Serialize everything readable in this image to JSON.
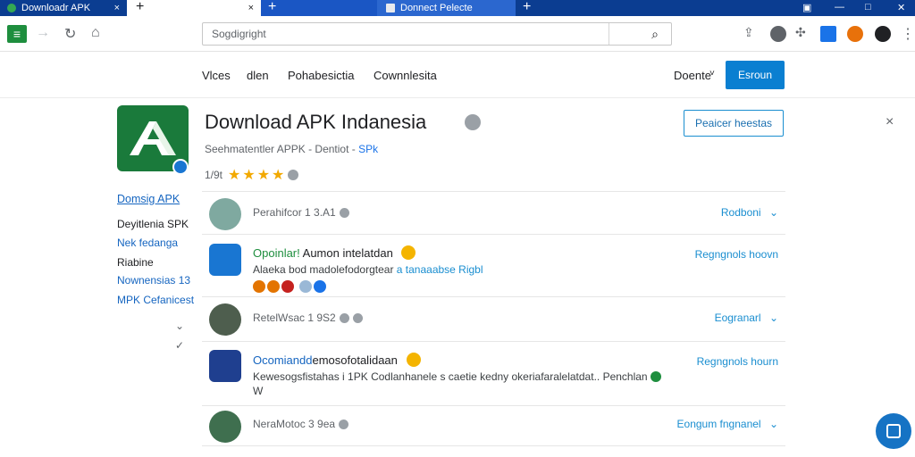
{
  "browser": {
    "tabs": [
      {
        "title": "Downloadr APK",
        "close": "×"
      },
      {
        "title": "",
        "close": "×"
      },
      {
        "title": "",
        "close": ""
      },
      {
        "title": "Donnect Pelecte",
        "close": ""
      }
    ],
    "new_tab": "+",
    "address": "Sogdigright",
    "toolbar_logo": "≡"
  },
  "site_nav": {
    "links": [
      "Vlces",
      "dlen",
      "Pohabesictia",
      "Cownnlesita"
    ],
    "dropdown": "Doente",
    "dropdown_caret": "˅",
    "primary_button": "Esroun"
  },
  "app": {
    "title": "Download APK Indanesia",
    "subtitle": "Seehmatentler APPK - Dentiot - ",
    "subtitle_link": "SPk",
    "rating_label": "1/9t",
    "stars": 4,
    "action_button": "Peaicer heestas",
    "close": "×"
  },
  "sidebar": {
    "heading": "Domsig APK",
    "items": [
      {
        "label": "Deyitlenia SPK",
        "color": "dark"
      },
      {
        "label": "Nek fedanga",
        "color": "blue"
      },
      {
        "label": "Riabine",
        "color": "dark"
      },
      {
        "label": "Nownensias 13",
        "color": "blue"
      },
      {
        "label": "MPK Cefanicest",
        "color": "blue"
      }
    ]
  },
  "list": [
    {
      "kind": "comment",
      "meta": "Perahifcor 1 3.A1",
      "action": "Rodboni"
    },
    {
      "kind": "app",
      "title_green": "Opoinlar!",
      "title_rest": " Aumon intelatdan",
      "desc": "Alaeka bod madolefodorgtear ",
      "desc_link": "a tanaaabse Rigbl",
      "action": "Regngnols hoovn"
    },
    {
      "kind": "comment",
      "meta": "RetelWsac 1 9S2",
      "action": "Eogranarl"
    },
    {
      "kind": "app",
      "title_blue": "Ocomiandd",
      "title_rest": "emosofotalidaan",
      "desc": "Kewesogsfistahas i 1PK Codlanhanele s caetie  kedny okeriafaralelatdat..  Penchlan",
      "desc2": "W",
      "action": "Regngnols hourn"
    },
    {
      "kind": "comment",
      "meta": "NeraMotoc 3 9ea",
      "action": "Eongum fngnanel"
    }
  ],
  "colors": {
    "accent": "#0a7fd1",
    "brand_green": "#1a7a3b",
    "tabbar": "#0b3d91"
  }
}
